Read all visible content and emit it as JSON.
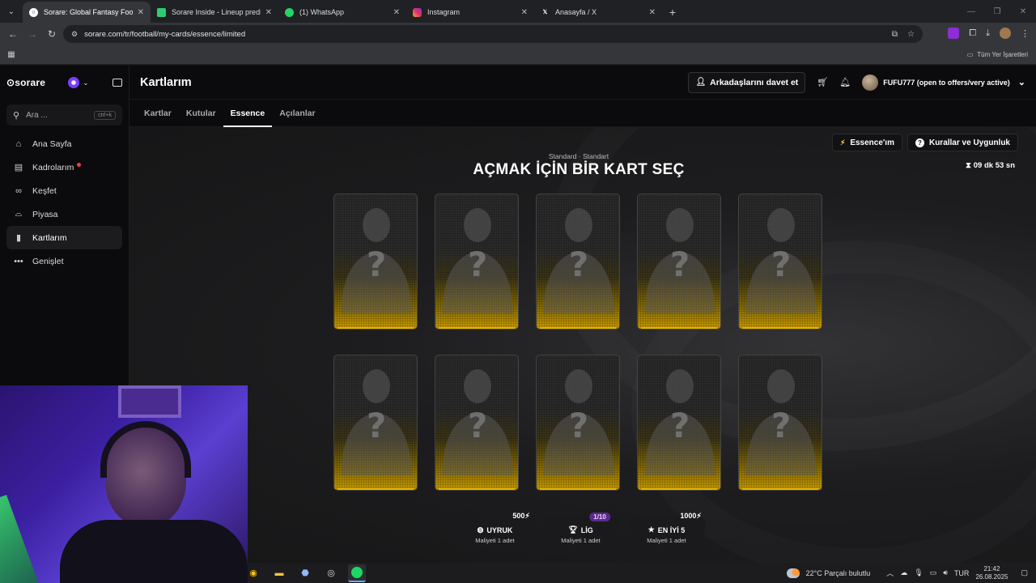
{
  "browser": {
    "tabs": [
      {
        "title": "Sorare: Global Fantasy Football",
        "icon": "sorare-favicon",
        "active": true
      },
      {
        "title": "Sorare Inside - Lineup predictio",
        "icon": "sorare-inside-favicon",
        "active": false
      },
      {
        "title": "(1) WhatsApp",
        "icon": "whatsapp-favicon",
        "active": false
      },
      {
        "title": "Instagram",
        "icon": "instagram-favicon",
        "active": false
      },
      {
        "title": "Anasayfa / X",
        "icon": "x-favicon",
        "active": false
      }
    ],
    "url": "sorare.com/tr/football/my-cards/essence/limited",
    "bookmarks_label": "Tüm Yer İşaretleri"
  },
  "sidebar": {
    "logo": "sorare",
    "search_placeholder": "Ara ...",
    "search_shortcut": "ctrl+k",
    "items": [
      {
        "label": "Ana Sayfa",
        "icon": "home-icon",
        "active": false,
        "dot": false
      },
      {
        "label": "Kadrolarım",
        "icon": "lineup-icon",
        "active": false,
        "dot": true
      },
      {
        "label": "Keşfet",
        "icon": "discover-icon",
        "active": false,
        "dot": false
      },
      {
        "label": "Piyasa",
        "icon": "market-icon",
        "active": false,
        "dot": false
      },
      {
        "label": "Kartlarım",
        "icon": "cards-icon",
        "active": true,
        "dot": false
      },
      {
        "label": "Genişlet",
        "icon": "more-icon",
        "active": false,
        "dot": false
      }
    ]
  },
  "header": {
    "title": "Kartlarım",
    "invite_label": "Arkadaşlarını davet et",
    "username": "FUFU777 (open to offers/very active)"
  },
  "tabs": [
    "Kartlar",
    "Kutular",
    "Essence",
    "Açılanlar"
  ],
  "active_tab": "Essence",
  "content": {
    "essence_button": "Essence'ım",
    "rules_button": "Kurallar ve Uygunluk",
    "timer": "09 dk 53 sn",
    "subtitle": "Standard · Standart",
    "heading": "AÇMAK İÇİN BİR KART SEÇ",
    "card_count": 10,
    "card_symbol": "?"
  },
  "costs": [
    {
      "label": "UYRUK",
      "sub": "Maliyeti 1 adet",
      "badge": "500",
      "badge_style": "essence",
      "icon": "globe-icon"
    },
    {
      "label": "LİG",
      "sub": "Maliyeti 1 adet",
      "badge": "1/10",
      "badge_style": "purple",
      "icon": "trophy-icon"
    },
    {
      "label": "EN İYİ 5",
      "sub": "Maliyeti 1 adet",
      "badge": "1000",
      "badge_style": "essence",
      "icon": "star-icon"
    }
  ],
  "taskbar": {
    "weather": "22°C  Parçalı bulutlu",
    "language": "TUR",
    "time": "21:42",
    "date": "26.08.2025"
  },
  "colors": {
    "card_gold": "#c99b00",
    "notification_dot": "#ff3b3b",
    "purple_badge": "#5b2a8c"
  }
}
